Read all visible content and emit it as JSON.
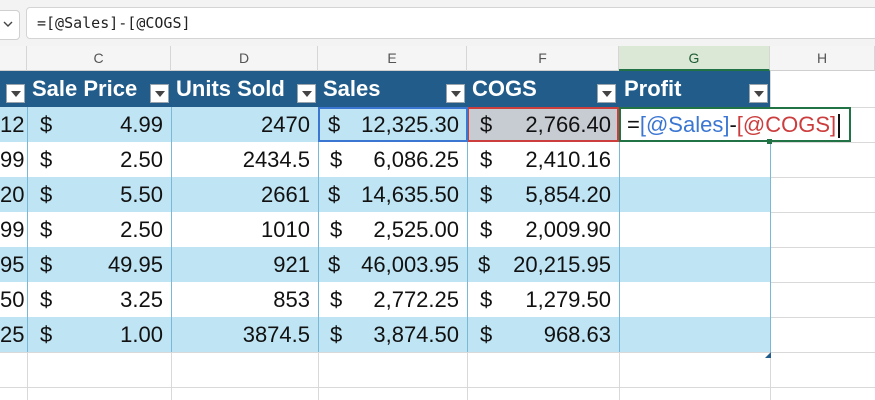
{
  "formula_bar": {
    "formula": "=[@Sales]-[@COGS]"
  },
  "columns": [
    "C",
    "D",
    "E",
    "F",
    "G",
    "H"
  ],
  "selected_column": "G",
  "table": {
    "headers": [
      "Sale Price",
      "Units Sold",
      "Sales",
      "COGS",
      "Profit"
    ],
    "rows": [
      {
        "partial": "12",
        "sale_price": "4.99",
        "units": "2470",
        "sales": "12,325.30",
        "cogs": "2,766.40"
      },
      {
        "partial": "99",
        "sale_price": "2.50",
        "units": "2434.5",
        "sales": "6,086.25",
        "cogs": "2,410.16"
      },
      {
        "partial": "20",
        "sale_price": "5.50",
        "units": "2661",
        "sales": "14,635.50",
        "cogs": "5,854.20"
      },
      {
        "partial": "99",
        "sale_price": "2.50",
        "units": "1010",
        "sales": "2,525.00",
        "cogs": "2,009.90"
      },
      {
        "partial": "95",
        "sale_price": "49.95",
        "units": "921",
        "sales": "46,003.95",
        "cogs": "20,215.95"
      },
      {
        "partial": "50",
        "sale_price": "3.25",
        "units": "853",
        "sales": "2,772.25",
        "cogs": "1,279.50"
      },
      {
        "partial": "25",
        "sale_price": "1.00",
        "units": "3874.5",
        "sales": "3,874.50",
        "cogs": "968.63"
      }
    ],
    "currency_symbol": "$"
  },
  "active_cell": {
    "eq": "=",
    "ref1": "[@Sales]",
    "op": "-",
    "ref2": "[@COGS]"
  },
  "colors": {
    "header_fill": "#215c8a",
    "band_fill": "#bfe4f3",
    "ref_blue": "#3b76d2",
    "ref_red": "#cc3d3d",
    "selection_green": "#217346"
  },
  "icons": {
    "filter": "filter-dropdown-icon",
    "name_box": "chevron-down-icon"
  }
}
